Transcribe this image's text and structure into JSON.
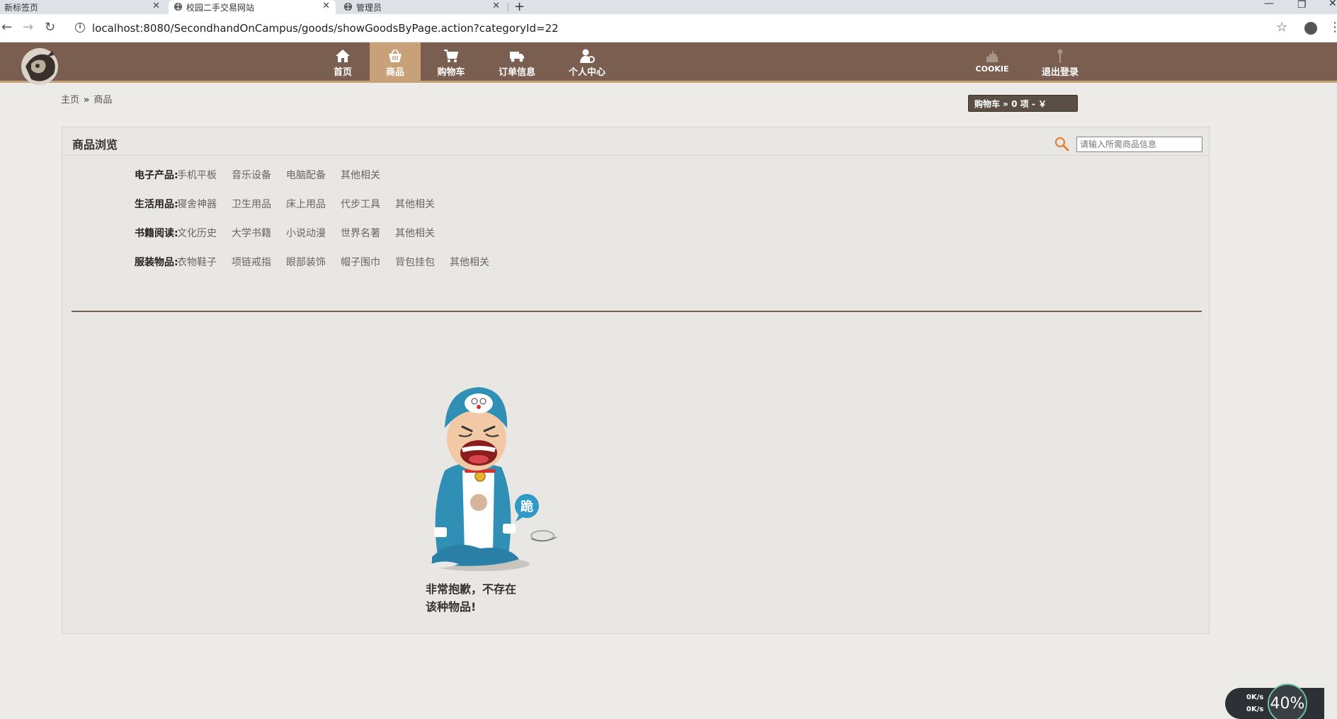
{
  "browser": {
    "tabs": [
      {
        "title": "新标签页"
      },
      {
        "title": "校园二手交易网站"
      },
      {
        "title": "管理员"
      }
    ],
    "new_tab": "+",
    "url": "localhost:8080/SecondhandOnCampus/goods/showGoodsByPage.action?categoryId=22"
  },
  "header": {
    "nav": [
      {
        "label": "首页",
        "icon": "home-icon"
      },
      {
        "label": "商品",
        "icon": "basket-icon"
      },
      {
        "label": "购物车",
        "icon": "cart-icon"
      },
      {
        "label": "订单信息",
        "icon": "truck-icon"
      },
      {
        "label": "个人中心",
        "icon": "user-icon"
      }
    ],
    "right": [
      {
        "label": "COOKIE",
        "icon": "cookie-icon"
      },
      {
        "label": "退出登录",
        "icon": "logout-icon"
      }
    ],
    "accent": "#c8a178",
    "bar_color": "#7a5f51"
  },
  "breadcrumb": {
    "home": "主页",
    "sep": "»",
    "current": "商品"
  },
  "cart_summary": "购物车  » 0 项 - ￥",
  "panel": {
    "title": "商品浏览",
    "search_placeholder": "请输入所需商品信息",
    "categories": [
      {
        "label": "电子产品:",
        "items": [
          "手机平板",
          "音乐设备",
          "电脑配备",
          "其他相关"
        ]
      },
      {
        "label": "生活用品:",
        "items": [
          "寝舍神器",
          "卫生用品",
          "床上用品",
          "代步工具",
          "其他相关"
        ]
      },
      {
        "label": "书籍阅读:",
        "items": [
          "文化历史",
          "大学书籍",
          "小说动漫",
          "世界名著",
          "其他相关"
        ]
      },
      {
        "label": "服装物品:",
        "items": [
          "衣物鞋子",
          "项链戒指",
          "眼部装饰",
          "帽子围巾",
          "背包挂包",
          "其他相关"
        ]
      }
    ],
    "empty_message_line1": "非常抱歉，不存在",
    "empty_message_line2": "该种物品!",
    "badge_char": "跪"
  },
  "speed_widget": {
    "up": "0K/s",
    "down": "0K/s",
    "percent": "40%"
  }
}
